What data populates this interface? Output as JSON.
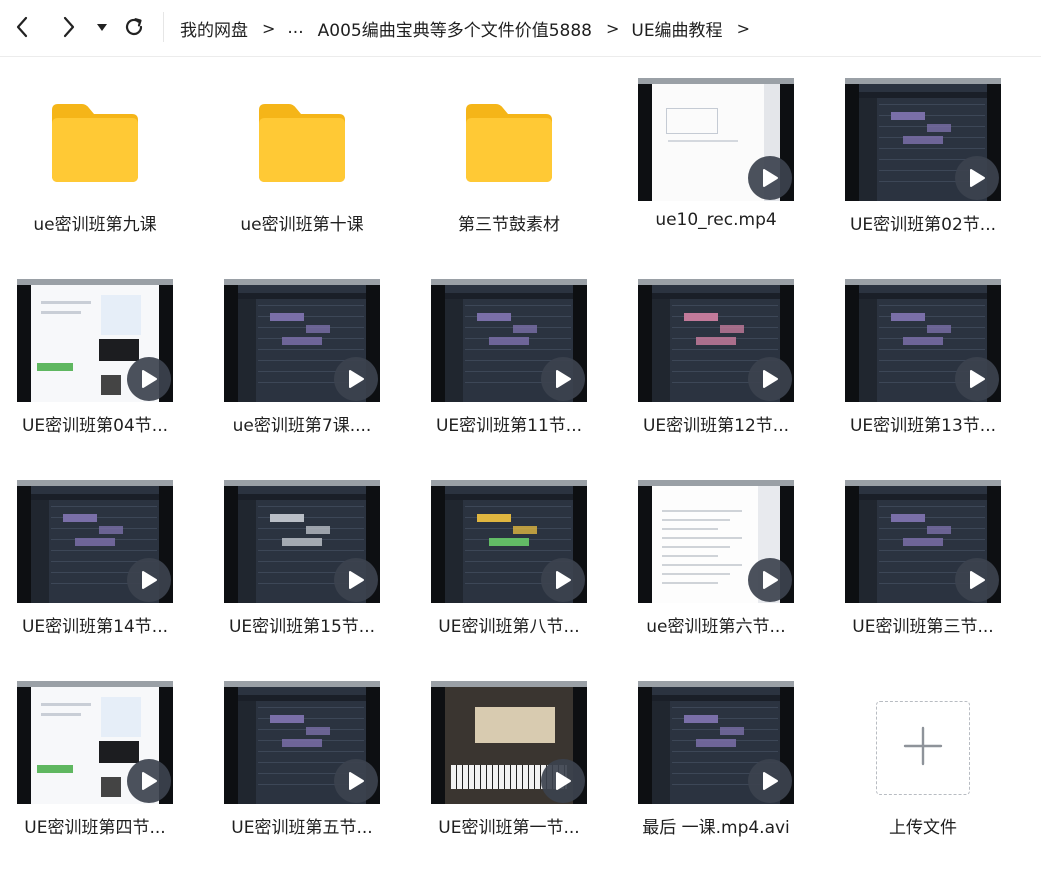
{
  "nav": {
    "back": "back-icon",
    "forward": "forward-icon",
    "dropdown": "caret-down-icon",
    "refresh": "refresh-icon"
  },
  "breadcrumb": {
    "items": [
      "我的网盘",
      "...",
      "A005编曲宝典等多个文件价值5888",
      "UE编曲教程"
    ],
    "separator": ">"
  },
  "files": [
    {
      "name": "ue密训班第九课",
      "type": "folder"
    },
    {
      "name": "ue密训班第十课",
      "type": "folder"
    },
    {
      "name": "第三节鼓素材",
      "type": "folder"
    },
    {
      "name": "ue10_rec.mp4",
      "type": "video",
      "theme": "white"
    },
    {
      "name": "UE密训班第02节...",
      "type": "video",
      "theme": "daw"
    },
    {
      "name": "UE密训班第04节...",
      "type": "video",
      "theme": "web"
    },
    {
      "name": "ue密训班第7课....",
      "type": "video",
      "theme": "daw"
    },
    {
      "name": "UE密训班第11节...",
      "type": "video",
      "theme": "daw"
    },
    {
      "name": "UE密训班第12节...",
      "type": "video",
      "theme": "daw-pink"
    },
    {
      "name": "UE密训班第13节...",
      "type": "video",
      "theme": "daw"
    },
    {
      "name": "UE密训班第14节...",
      "type": "video",
      "theme": "daw"
    },
    {
      "name": "UE密训班第15节...",
      "type": "video",
      "theme": "daw-grey"
    },
    {
      "name": "UE密训班第八节...",
      "type": "video",
      "theme": "daw-color"
    },
    {
      "name": "ue密训班第六节...",
      "type": "video",
      "theme": "doc"
    },
    {
      "name": "UE密训班第三节...",
      "type": "video",
      "theme": "daw"
    },
    {
      "name": "UE密训班第四节...",
      "type": "video",
      "theme": "web"
    },
    {
      "name": "UE密训班第五节...",
      "type": "video",
      "theme": "daw"
    },
    {
      "name": "UE密训班第一节...",
      "type": "video",
      "theme": "plugin"
    },
    {
      "name": "最后 一课.mp4.avi",
      "type": "video",
      "theme": "daw"
    }
  ],
  "upload": {
    "label": "上传文件",
    "icon": "plus-icon"
  },
  "colors": {
    "folder": "#FFC935",
    "folder_dark": "#F5B518",
    "play_button": "#3C424E"
  }
}
